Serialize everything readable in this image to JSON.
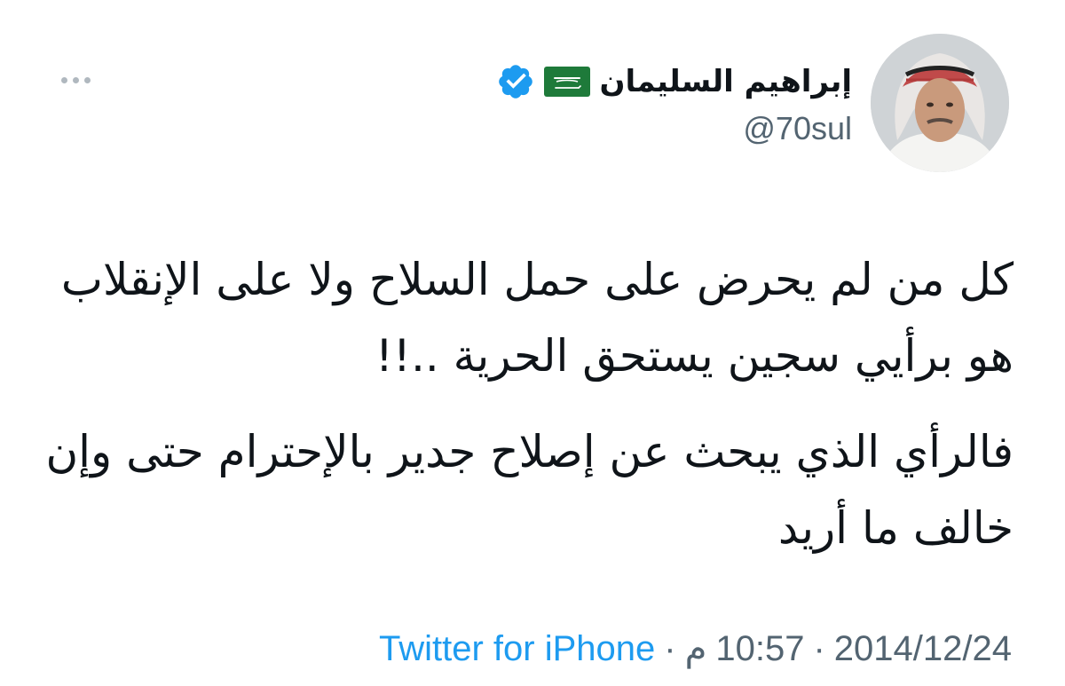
{
  "author": {
    "display_name": "إبراهيم السليمان",
    "handle": "@70sul",
    "flag_icon": "saudi-flag-icon",
    "verified_icon": "verified-badge-icon",
    "verified_color": "#1d9bf0"
  },
  "tweet": {
    "paragraph_1": "كل من لم يحرض على حمل السلاح ولا على الإنقلاب هو برأيي سجين يستحق الحرية ..!!",
    "paragraph_2": "فالرأي الذي يبحث عن إصلاح جدير بالإحترام حتى وإن خالف ما أريد"
  },
  "meta": {
    "date": "2014/12/24",
    "time": "10:57",
    "ampm": "م",
    "separator": "·",
    "source": "Twitter for iPhone"
  },
  "colors": {
    "text_primary": "#0f1419",
    "text_secondary": "#536471",
    "link": "#1d9bf0"
  },
  "icons": {
    "more": "more-horizontal-icon"
  }
}
